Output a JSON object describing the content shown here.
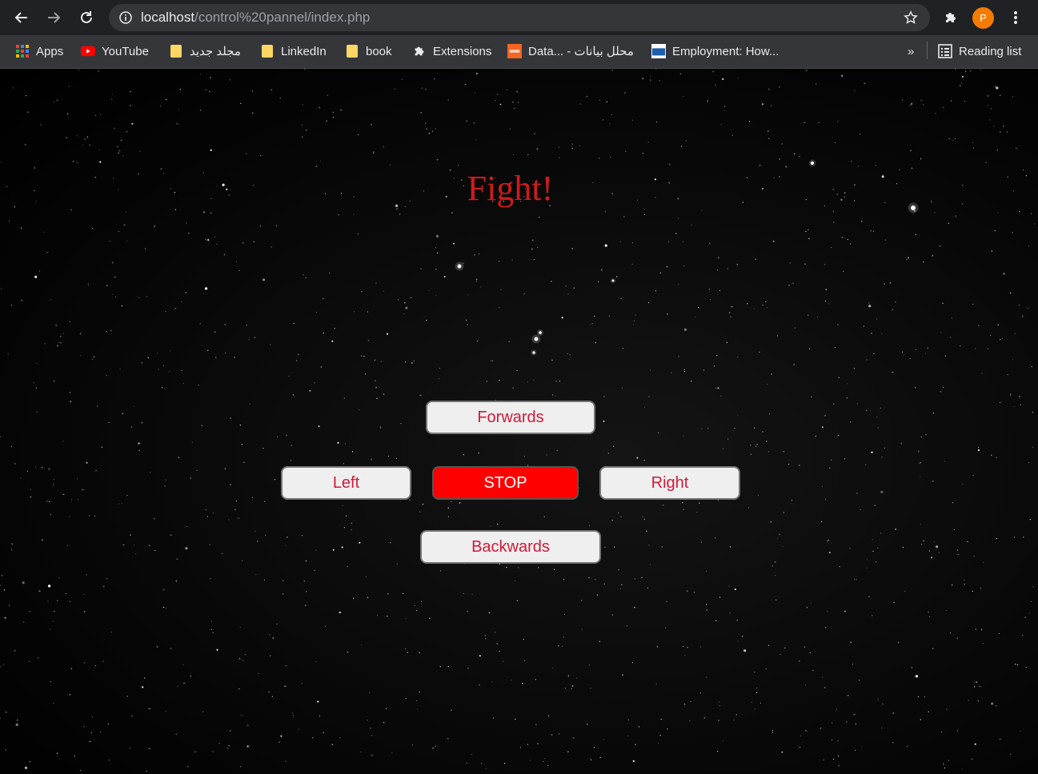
{
  "browser": {
    "url_host": "localhost",
    "url_path": "/control%20pannel/index.php",
    "profile_initial": "P",
    "bookmarks": [
      {
        "label": "Apps",
        "icon": "apps-grid-icon"
      },
      {
        "label": "YouTube",
        "icon": "youtube-icon"
      },
      {
        "label": "مجلد جديد",
        "icon": "folder-icon"
      },
      {
        "label": "LinkedIn",
        "icon": "folder-icon"
      },
      {
        "label": "book",
        "icon": "folder-icon"
      },
      {
        "label": "Extensions",
        "icon": "puzzle-icon"
      },
      {
        "label": "Data... - محلل بيانات",
        "icon": "site-icon"
      },
      {
        "label": "Employment: How...",
        "icon": "sam-icon"
      }
    ],
    "overflow_label": "»",
    "reading_list_label": "Reading list"
  },
  "page": {
    "title": "Fight!",
    "buttons": {
      "forwards": "Forwards",
      "left": "Left",
      "stop": "STOP",
      "right": "Right",
      "backwards": "Backwards"
    }
  },
  "colors": {
    "title": "#d11a1a",
    "button_text": "#d11a3a",
    "stop_bg": "#ff0000"
  }
}
